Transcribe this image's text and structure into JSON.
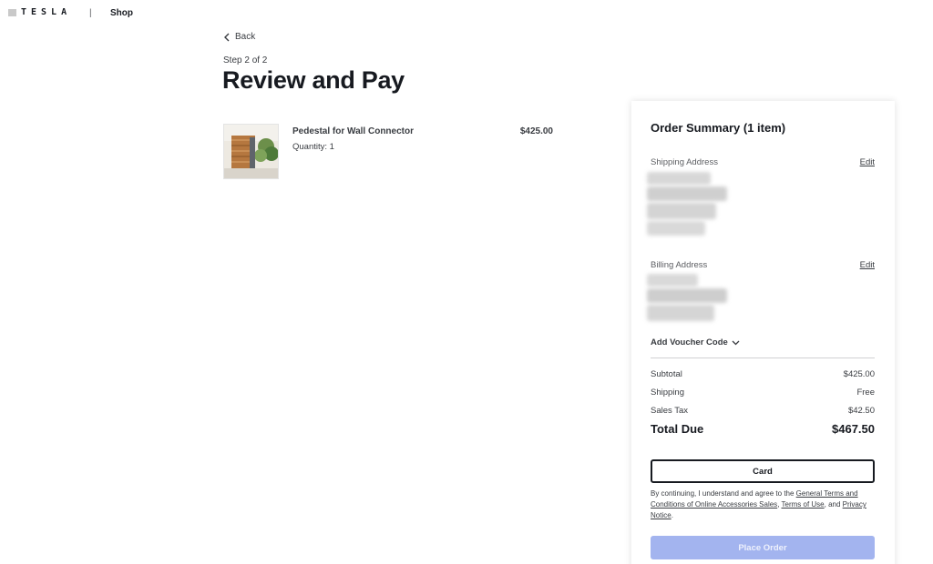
{
  "header": {
    "logo_text": "TESLA",
    "separator": "|",
    "shop_label": "Shop"
  },
  "nav": {
    "back_label": "Back"
  },
  "page": {
    "step": "Step 2 of 2",
    "title": "Review and Pay"
  },
  "cart_item": {
    "name": "Pedestal for Wall Connector",
    "quantity_label": "Quantity: 1",
    "price": "$425.00"
  },
  "summary": {
    "title": "Order Summary (1 item)",
    "shipping_address_label": "Shipping Address",
    "billing_address_label": "Billing Address",
    "edit_label": "Edit",
    "voucher_label": "Add Voucher Code",
    "rows": [
      {
        "label": "Subtotal",
        "value": "$425.00"
      },
      {
        "label": "Shipping",
        "value": "Free"
      },
      {
        "label": "Sales Tax",
        "value": "$42.50"
      }
    ],
    "total": {
      "label": "Total Due",
      "value": "$467.50"
    },
    "payment_method_label": "Card",
    "legal": {
      "prefix": "By continuing, I understand and agree to the ",
      "link1": "General Terms and Conditions of Online Accessories Sales",
      "sep1": ", ",
      "link2": "Terms of Use",
      "sep2": ", and ",
      "link3": "Privacy Notice",
      "suffix": "."
    },
    "place_order_label": "Place Order"
  },
  "colors": {
    "text_primary": "#171a20",
    "text_secondary": "#393c41",
    "place_order_disabled": "#a3b4ef"
  },
  "icons": {
    "back": "chevron-left-icon",
    "voucher": "chevron-down-icon"
  }
}
